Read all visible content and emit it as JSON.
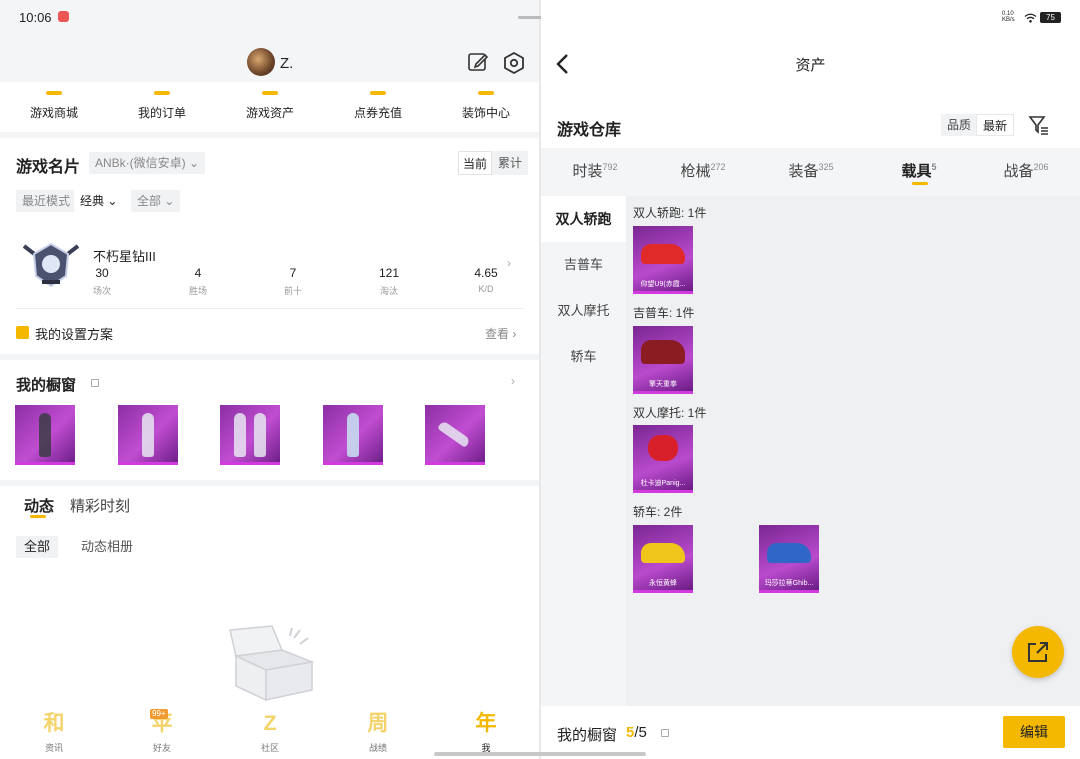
{
  "status": {
    "time": "10:06",
    "net_speed": "0.10\nKB/s",
    "battery": "75"
  },
  "profile": {
    "username": "Z."
  },
  "quicknav": [
    "游戏商城",
    "我的订单",
    "游戏资产",
    "点券充值",
    "装饰中心"
  ],
  "namecard": {
    "title": "游戏名片",
    "account": "ANBk·(微信安卓)",
    "segments": [
      "当前",
      "累计"
    ],
    "mode_label": "最近模式",
    "mode_value": "经典",
    "scope_value": "全部",
    "rank": "不朽星钻III",
    "stats": [
      {
        "value": "30",
        "label": "场次"
      },
      {
        "value": "4",
        "label": "胜场"
      },
      {
        "value": "7",
        "label": "前十"
      },
      {
        "value": "121",
        "label": "淘汰"
      },
      {
        "value": "4.65",
        "label": "K/D"
      }
    ],
    "plan_label": "我的设置方案",
    "plan_link": "查看"
  },
  "showcase": {
    "title": "我的橱窗"
  },
  "feed": {
    "tabs": [
      "动态",
      "精彩时刻"
    ],
    "chips": [
      "全部",
      "动态相册"
    ]
  },
  "bottom_nav": [
    {
      "label": "资讯",
      "glyph": "和"
    },
    {
      "label": "好友",
      "glyph": "苹",
      "badge": "99+"
    },
    {
      "label": "社区",
      "glyph": "Z"
    },
    {
      "label": "战绩",
      "glyph": "周"
    },
    {
      "label": "我",
      "glyph": "年",
      "active": true
    }
  ],
  "assets": {
    "title": "资产",
    "warehouse_title": "游戏仓库",
    "sort": [
      "品质",
      "最新"
    ],
    "categories": [
      {
        "label": "时装",
        "count": "792"
      },
      {
        "label": "枪械",
        "count": "272"
      },
      {
        "label": "装备",
        "count": "325"
      },
      {
        "label": "载具",
        "count": "5",
        "active": true
      },
      {
        "label": "战备",
        "count": "206"
      }
    ],
    "subnav": [
      "双人轿跑",
      "吉普车",
      "双人摩托",
      "轿车"
    ],
    "groups": [
      {
        "title": "双人轿跑: 1件",
        "items": [
          "仰望U9(赤霞..."
        ]
      },
      {
        "title": "吉普车: 1件",
        "items": [
          "擎天重拳"
        ]
      },
      {
        "title": "双人摩托: 1件",
        "items": [
          "杜卡迪Panig..."
        ]
      },
      {
        "title": "轿车: 2件",
        "items": [
          "永恒黄蜂",
          "玛莎拉蒂Ghib..."
        ]
      }
    ],
    "showcase_label": "我的橱窗",
    "showcase_used": "5",
    "showcase_total": "/5",
    "edit_label": "编辑"
  },
  "colors": {
    "accent": "#f5b800",
    "rarity_purple": "#b94acd"
  }
}
